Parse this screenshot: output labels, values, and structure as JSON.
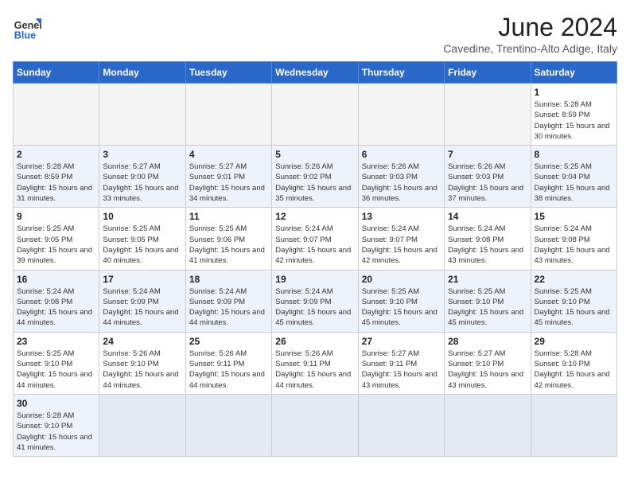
{
  "header": {
    "logo_line1": "General",
    "logo_line2": "Blue",
    "month_title": "June 2024",
    "location": "Cavedine, Trentino-Alto Adige, Italy"
  },
  "weekdays": [
    "Sunday",
    "Monday",
    "Tuesday",
    "Wednesday",
    "Thursday",
    "Friday",
    "Saturday"
  ],
  "weeks": [
    [
      {
        "day": "",
        "info": ""
      },
      {
        "day": "",
        "info": ""
      },
      {
        "day": "",
        "info": ""
      },
      {
        "day": "",
        "info": ""
      },
      {
        "day": "",
        "info": ""
      },
      {
        "day": "",
        "info": ""
      },
      {
        "day": "1",
        "info": "Sunrise: 5:28 AM\nSunset: 8:59 PM\nDaylight: 15 hours and 30 minutes."
      }
    ],
    [
      {
        "day": "2",
        "info": "Sunrise: 5:28 AM\nSunset: 8:59 PM\nDaylight: 15 hours and 31 minutes."
      },
      {
        "day": "3",
        "info": "Sunrise: 5:27 AM\nSunset: 9:00 PM\nDaylight: 15 hours and 33 minutes."
      },
      {
        "day": "4",
        "info": "Sunrise: 5:27 AM\nSunset: 9:01 PM\nDaylight: 15 hours and 34 minutes."
      },
      {
        "day": "5",
        "info": "Sunrise: 5:26 AM\nSunset: 9:02 PM\nDaylight: 15 hours and 35 minutes."
      },
      {
        "day": "6",
        "info": "Sunrise: 5:26 AM\nSunset: 9:03 PM\nDaylight: 15 hours and 36 minutes."
      },
      {
        "day": "7",
        "info": "Sunrise: 5:26 AM\nSunset: 9:03 PM\nDaylight: 15 hours and 37 minutes."
      },
      {
        "day": "8",
        "info": "Sunrise: 5:25 AM\nSunset: 9:04 PM\nDaylight: 15 hours and 38 minutes."
      }
    ],
    [
      {
        "day": "9",
        "info": "Sunrise: 5:25 AM\nSunset: 9:05 PM\nDaylight: 15 hours and 39 minutes."
      },
      {
        "day": "10",
        "info": "Sunrise: 5:25 AM\nSunset: 9:05 PM\nDaylight: 15 hours and 40 minutes."
      },
      {
        "day": "11",
        "info": "Sunrise: 5:25 AM\nSunset: 9:06 PM\nDaylight: 15 hours and 41 minutes."
      },
      {
        "day": "12",
        "info": "Sunrise: 5:24 AM\nSunset: 9:07 PM\nDaylight: 15 hours and 42 minutes."
      },
      {
        "day": "13",
        "info": "Sunrise: 5:24 AM\nSunset: 9:07 PM\nDaylight: 15 hours and 42 minutes."
      },
      {
        "day": "14",
        "info": "Sunrise: 5:24 AM\nSunset: 9:08 PM\nDaylight: 15 hours and 43 minutes."
      },
      {
        "day": "15",
        "info": "Sunrise: 5:24 AM\nSunset: 9:08 PM\nDaylight: 15 hours and 43 minutes."
      }
    ],
    [
      {
        "day": "16",
        "info": "Sunrise: 5:24 AM\nSunset: 9:08 PM\nDaylight: 15 hours and 44 minutes."
      },
      {
        "day": "17",
        "info": "Sunrise: 5:24 AM\nSunset: 9:09 PM\nDaylight: 15 hours and 44 minutes."
      },
      {
        "day": "18",
        "info": "Sunrise: 5:24 AM\nSunset: 9:09 PM\nDaylight: 15 hours and 44 minutes."
      },
      {
        "day": "19",
        "info": "Sunrise: 5:24 AM\nSunset: 9:09 PM\nDaylight: 15 hours and 45 minutes."
      },
      {
        "day": "20",
        "info": "Sunrise: 5:25 AM\nSunset: 9:10 PM\nDaylight: 15 hours and 45 minutes."
      },
      {
        "day": "21",
        "info": "Sunrise: 5:25 AM\nSunset: 9:10 PM\nDaylight: 15 hours and 45 minutes."
      },
      {
        "day": "22",
        "info": "Sunrise: 5:25 AM\nSunset: 9:10 PM\nDaylight: 15 hours and 45 minutes."
      }
    ],
    [
      {
        "day": "23",
        "info": "Sunrise: 5:25 AM\nSunset: 9:10 PM\nDaylight: 15 hours and 44 minutes."
      },
      {
        "day": "24",
        "info": "Sunrise: 5:26 AM\nSunset: 9:10 PM\nDaylight: 15 hours and 44 minutes."
      },
      {
        "day": "25",
        "info": "Sunrise: 5:26 AM\nSunset: 9:11 PM\nDaylight: 15 hours and 44 minutes."
      },
      {
        "day": "26",
        "info": "Sunrise: 5:26 AM\nSunset: 9:11 PM\nDaylight: 15 hours and 44 minutes."
      },
      {
        "day": "27",
        "info": "Sunrise: 5:27 AM\nSunset: 9:11 PM\nDaylight: 15 hours and 43 minutes."
      },
      {
        "day": "28",
        "info": "Sunrise: 5:27 AM\nSunset: 9:10 PM\nDaylight: 15 hours and 43 minutes."
      },
      {
        "day": "29",
        "info": "Sunrise: 5:28 AM\nSunset: 9:10 PM\nDaylight: 15 hours and 42 minutes."
      }
    ],
    [
      {
        "day": "30",
        "info": "Sunrise: 5:28 AM\nSunset: 9:10 PM\nDaylight: 15 hours and 41 minutes."
      },
      {
        "day": "",
        "info": ""
      },
      {
        "day": "",
        "info": ""
      },
      {
        "day": "",
        "info": ""
      },
      {
        "day": "",
        "info": ""
      },
      {
        "day": "",
        "info": ""
      },
      {
        "day": "",
        "info": ""
      }
    ]
  ]
}
